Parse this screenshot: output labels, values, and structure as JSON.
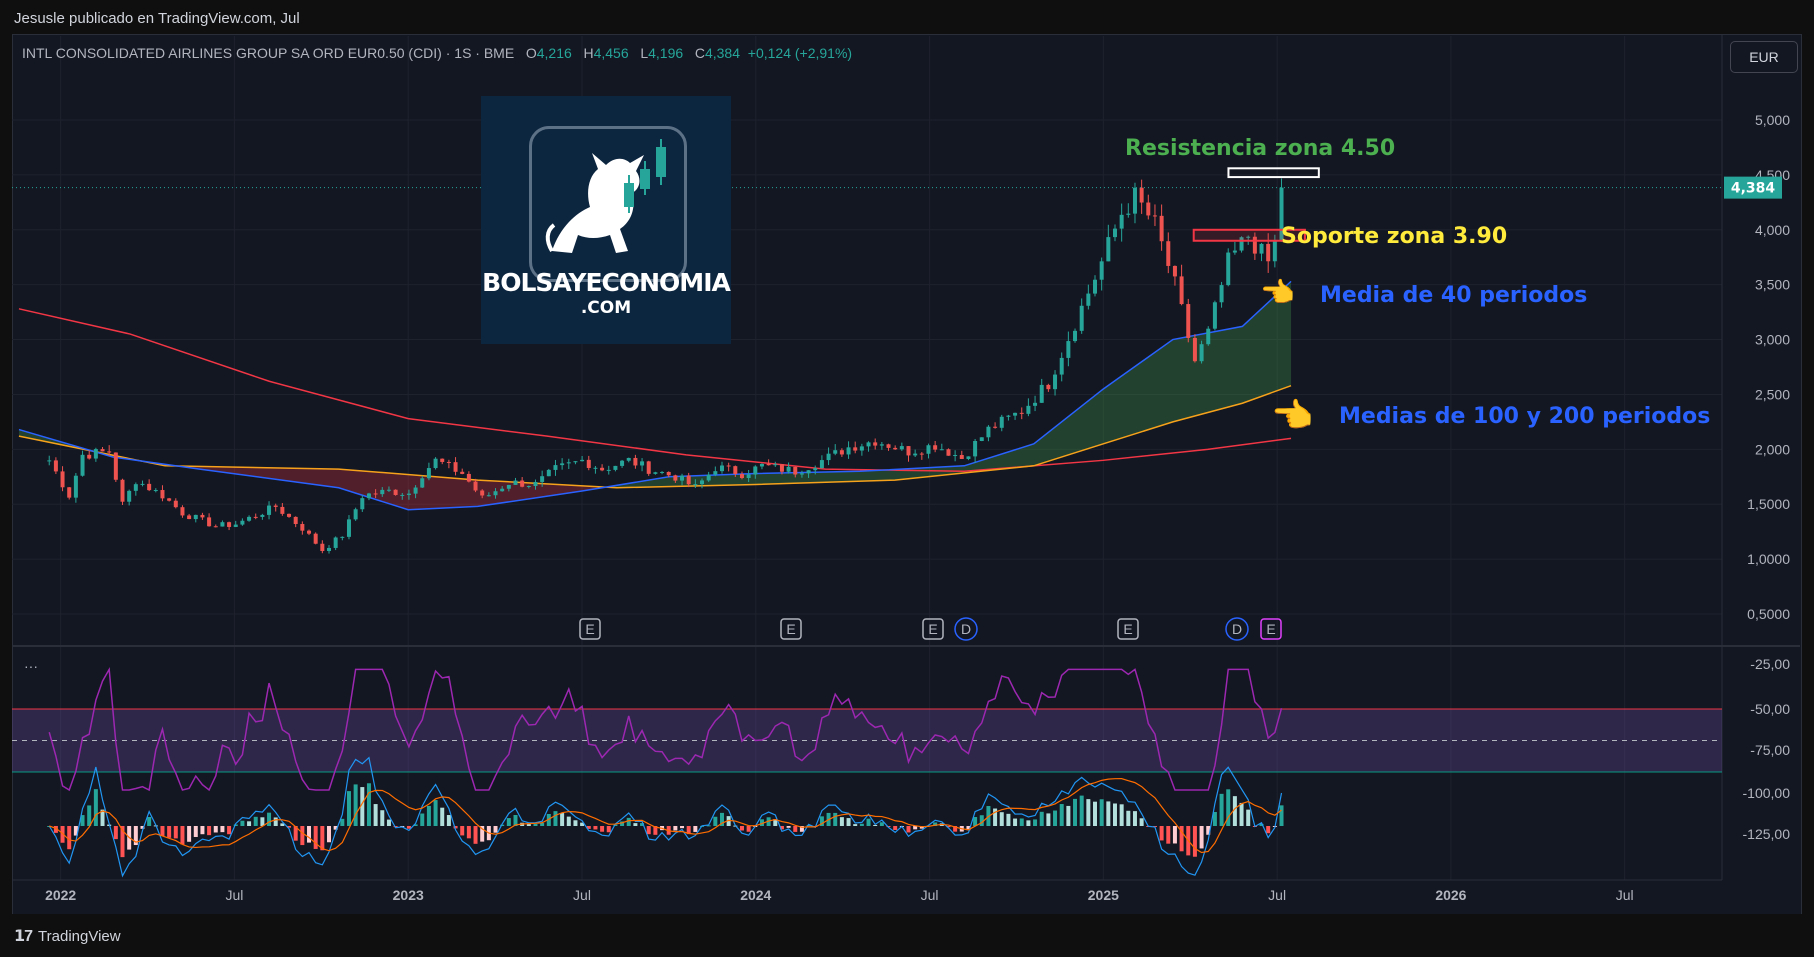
{
  "header": {
    "publisher": "Jesusle publicado en TradingView.com, Jul"
  },
  "legend": {
    "symbol": "INTL CONSOLIDATED AIRLINES GROUP SA ORD EUR0.50 (CDI) · 1S · BME",
    "o_label": "O",
    "o": "4,216",
    "h_label": "H",
    "h": "4,456",
    "l_label": "L",
    "l": "4,196",
    "c_label": "C",
    "c": "4,384",
    "change": "+0,124 (+2,91%)"
  },
  "currency": "EUR",
  "footer": {
    "brand": "TradingView"
  },
  "watermark": {
    "name": "BOLSAYECONOMIA",
    "sub": ".COM"
  },
  "annotations": {
    "resistance": "Resistencia zona 4.50",
    "support": "Soporte zona 3.90",
    "ma40": "Media de 40 periodos",
    "ma100_200": "Medias de 100 y 200 periodos",
    "pointer": "👈"
  },
  "colors": {
    "up": "#26a69a",
    "down": "#ef5350",
    "ma40": "#2962ff",
    "ma100": "#f7a21b",
    "ma200": "#f23645",
    "rsi": "#9c27b0",
    "macd": "#2196f3",
    "signal": "#ff6d00",
    "resistance_text": "#4caf50",
    "support_text": "#ffeb3b",
    "ma_text": "#2962ff"
  },
  "chart_data": {
    "type": "candlestick",
    "title": "INTL CONSOLIDATED AIRLINES GROUP SA ORD EUR0.50 (CDI)",
    "timeframe": "1S",
    "exchange": "BME",
    "last_price": "4,384",
    "y_ticks": [
      "5,000",
      "4,500",
      "4,000",
      "3,500",
      "3,000",
      "2,500",
      "2,000",
      "1,5000",
      "1,0000",
      "0,5000"
    ],
    "x_ticks": [
      "2022",
      "Jul",
      "2023",
      "Jul",
      "2024",
      "Jul",
      "2025",
      "Jul",
      "2026",
      "Jul"
    ],
    "ylim": [
      0.3,
      5.5
    ],
    "price_path": [
      [
        "2021-12-20",
        1.9
      ],
      [
        "2022-01-10",
        1.58
      ],
      [
        "2022-01-24",
        1.95
      ],
      [
        "2022-02-21",
        1.98
      ],
      [
        "2022-03-07",
        1.5
      ],
      [
        "2022-03-21",
        1.72
      ],
      [
        "2022-04-18",
        1.58
      ],
      [
        "2022-05-09",
        1.42
      ],
      [
        "2022-06-13",
        1.3
      ],
      [
        "2022-07-04",
        1.32
      ],
      [
        "2022-08-15",
        1.48
      ],
      [
        "2022-09-12",
        1.28
      ],
      [
        "2022-10-03",
        1.08
      ],
      [
        "2022-10-24",
        1.22
      ],
      [
        "2022-11-14",
        1.58
      ],
      [
        "2022-12-12",
        1.62
      ],
      [
        "2023-01-02",
        1.6
      ],
      [
        "2023-01-16",
        1.78
      ],
      [
        "2023-01-30",
        1.9
      ],
      [
        "2023-02-27",
        1.78
      ],
      [
        "2023-03-20",
        1.55
      ],
      [
        "2023-04-17",
        1.7
      ],
      [
        "2023-05-15",
        1.68
      ],
      [
        "2023-06-05",
        1.82
      ],
      [
        "2023-07-03",
        1.9
      ],
      [
        "2023-07-24",
        1.82
      ],
      [
        "2023-08-21",
        1.9
      ],
      [
        "2023-09-11",
        1.82
      ],
      [
        "2023-10-09",
        1.75
      ],
      [
        "2023-10-30",
        1.65
      ],
      [
        "2023-11-20",
        1.84
      ],
      [
        "2023-12-18",
        1.78
      ],
      [
        "2024-01-08",
        1.85
      ],
      [
        "2024-02-12",
        1.8
      ],
      [
        "2024-03-11",
        1.9
      ],
      [
        "2024-04-08",
        2.02
      ],
      [
        "2024-05-06",
        2.08
      ],
      [
        "2024-06-10",
        1.98
      ],
      [
        "2024-07-08",
        2.04
      ],
      [
        "2024-08-05",
        1.92
      ],
      [
        "2024-09-02",
        2.18
      ],
      [
        "2024-10-07",
        2.35
      ],
      [
        "2024-11-04",
        2.6
      ],
      [
        "2024-12-02",
        3.15
      ],
      [
        "2024-12-30",
        3.7
      ],
      [
        "2025-01-20",
        4.15
      ],
      [
        "2025-02-03",
        4.3
      ],
      [
        "2025-02-24",
        4.05
      ],
      [
        "2025-03-17",
        3.5
      ],
      [
        "2025-04-07",
        2.8
      ],
      [
        "2025-04-21",
        3.05
      ],
      [
        "2025-05-12",
        3.7
      ],
      [
        "2025-06-02",
        3.95
      ],
      [
        "2025-06-23",
        3.7
      ],
      [
        "2025-07-07",
        4.05
      ],
      [
        "2025-07-14",
        4.384
      ]
    ],
    "ma40": [
      [
        2021.88,
        2.18
      ],
      [
        2022.15,
        1.93
      ],
      [
        2022.4,
        1.82
      ],
      [
        2022.8,
        1.65
      ],
      [
        2023.0,
        1.45
      ],
      [
        2023.2,
        1.48
      ],
      [
        2023.5,
        1.62
      ],
      [
        2023.75,
        1.75
      ],
      [
        2024.0,
        1.78
      ],
      [
        2024.3,
        1.8
      ],
      [
        2024.6,
        1.85
      ],
      [
        2024.8,
        2.05
      ],
      [
        2025.0,
        2.55
      ],
      [
        2025.2,
        3.0
      ],
      [
        2025.4,
        3.12
      ],
      [
        2025.54,
        3.53
      ]
    ],
    "ma100": [
      [
        2021.88,
        2.12
      ],
      [
        2022.3,
        1.85
      ],
      [
        2022.8,
        1.82
      ],
      [
        2023.2,
        1.72
      ],
      [
        2023.6,
        1.65
      ],
      [
        2024.0,
        1.68
      ],
      [
        2024.4,
        1.72
      ],
      [
        2024.8,
        1.85
      ],
      [
        2025.0,
        2.05
      ],
      [
        2025.2,
        2.25
      ],
      [
        2025.4,
        2.42
      ],
      [
        2025.54,
        2.58
      ]
    ],
    "ma200": [
      [
        2021.88,
        3.28
      ],
      [
        2022.2,
        3.05
      ],
      [
        2022.6,
        2.62
      ],
      [
        2023.0,
        2.28
      ],
      [
        2023.4,
        2.12
      ],
      [
        2023.8,
        1.95
      ],
      [
        2024.2,
        1.82
      ],
      [
        2024.6,
        1.8
      ],
      [
        2025.0,
        1.9
      ],
      [
        2025.3,
        2.0
      ],
      [
        2025.54,
        2.1
      ]
    ],
    "levels": {
      "resistance": 4.5,
      "support": 3.9
    },
    "earnings_markers": [
      "E",
      "E",
      "E",
      "D",
      "E",
      "D",
      "E"
    ],
    "rsi": {
      "ticks": [
        "-25,00",
        "-50,00",
        "-75,00",
        "-100,00",
        "-125,00"
      ],
      "band": [
        -50,
        -75
      ]
    },
    "macd": {
      "ticks": [
        "-100,00",
        "-125,00"
      ]
    }
  }
}
